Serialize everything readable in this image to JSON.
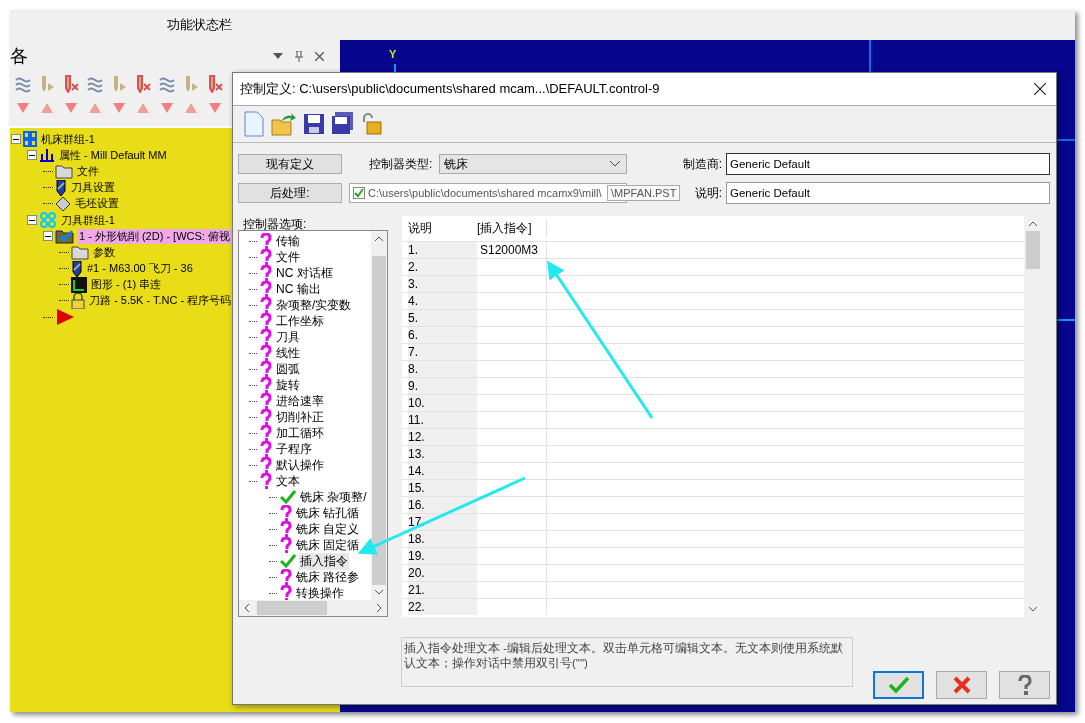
{
  "status_bar": {
    "title": "功能状态栏"
  },
  "manager": {
    "title": "各",
    "tree": [
      {
        "label": "机床群组-1",
        "kind": "machine_group",
        "expanded": true,
        "selected": false,
        "children": [
          {
            "label": "属性 - Mill Default MM",
            "kind": "properties",
            "expanded": true,
            "selected": false,
            "children": [
              {
                "label": "文件",
                "kind": "folder",
                "selected": false
              },
              {
                "label": "刀具设置",
                "kind": "tool",
                "selected": false
              },
              {
                "label": "毛坯设置",
                "kind": "stock",
                "selected": false
              }
            ]
          },
          {
            "label": "刀具群组-1",
            "kind": "tool_group",
            "expanded": true,
            "selected": false,
            "children": [
              {
                "label": "1 - 外形铣削 (2D) - [WCS: 俯视",
                "kind": "operation",
                "expanded": true,
                "selected": true,
                "children": [
                  {
                    "label": "参数",
                    "kind": "folder",
                    "selected": false
                  },
                  {
                    "label": "#1 - M63.00 飞刀 - 36",
                    "kind": "tool",
                    "selected": false
                  },
                  {
                    "label": "图形 - (1) 串连",
                    "kind": "geometry",
                    "selected": false
                  },
                  {
                    "label": "刀路 - 5.5K - T.NC - 程序号码",
                    "kind": "toolpath",
                    "selected": false
                  }
                ]
              },
              {
                "kind": "insert_marker",
                "selected": false
              }
            ]
          }
        ]
      }
    ]
  },
  "viewport": {
    "axis_label": "Y"
  },
  "dialog": {
    "title": "控制定义: C:\\users\\public\\documents\\shared mcam...\\DEFAULT.control-9",
    "current_button": "现有定义",
    "post_button": "后处理:",
    "controller_type": {
      "label": "控制器类型:",
      "value": "铣床"
    },
    "post_path": "C:\\users\\public\\documents\\shared mcamx9\\mill\\",
    "post_tooltip": "\\MPFAN.PST",
    "manufacturer": {
      "label": "制造商:",
      "value": "Generic Default"
    },
    "description": {
      "label": "说明:",
      "value": "Generic Default"
    },
    "options_label": "控制器选项:",
    "options": [
      {
        "label": "传输",
        "checked": false,
        "selected": false
      },
      {
        "label": "文件",
        "checked": false,
        "selected": false
      },
      {
        "label": "NC 对话框",
        "checked": false,
        "selected": false
      },
      {
        "label": "NC 输出",
        "checked": false,
        "selected": false
      },
      {
        "label": "杂项整/实变数",
        "checked": false,
        "selected": false
      },
      {
        "label": "工作坐标",
        "checked": false,
        "selected": false
      },
      {
        "label": "刀具",
        "checked": false,
        "selected": false
      },
      {
        "label": "线性",
        "checked": false,
        "selected": false
      },
      {
        "label": "圆弧",
        "checked": false,
        "selected": false
      },
      {
        "label": "旋转",
        "checked": false,
        "selected": false
      },
      {
        "label": "进给速率",
        "checked": false,
        "selected": false
      },
      {
        "label": "切削补正",
        "checked": false,
        "selected": false
      },
      {
        "label": "加工循环",
        "checked": false,
        "selected": false
      },
      {
        "label": "子程序",
        "checked": false,
        "selected": false
      },
      {
        "label": "默认操作",
        "checked": false,
        "selected": false
      },
      {
        "label": "文本",
        "checked": false,
        "selected": false,
        "children": [
          {
            "label": "铣床 杂项整/",
            "checked": true,
            "selected": false
          },
          {
            "label": "铣床 钻孔循",
            "checked": false,
            "selected": false
          },
          {
            "label": "铣床 自定义",
            "checked": false,
            "selected": false
          },
          {
            "label": "铣床 固定循",
            "checked": false,
            "selected": false
          },
          {
            "label": "插入指令",
            "checked": true,
            "selected": true
          },
          {
            "label": "铣床 路径参",
            "checked": false,
            "selected": false
          },
          {
            "label": "转换操作",
            "checked": false,
            "selected": false
          }
        ]
      }
    ],
    "table": {
      "columns": [
        "说明",
        "[插入指令]"
      ],
      "rows": [
        {
          "label": "1.",
          "value": "S12000M3"
        },
        {
          "label": "2."
        },
        {
          "label": "3."
        },
        {
          "label": "4."
        },
        {
          "label": "5."
        },
        {
          "label": "6."
        },
        {
          "label": "7."
        },
        {
          "label": "8."
        },
        {
          "label": "9."
        },
        {
          "label": "10."
        },
        {
          "label": "11."
        },
        {
          "label": "12."
        },
        {
          "label": "13."
        },
        {
          "label": "14."
        },
        {
          "label": "15."
        },
        {
          "label": "16."
        },
        {
          "label": "17."
        },
        {
          "label": "18."
        },
        {
          "label": "19."
        },
        {
          "label": "20."
        },
        {
          "label": "21."
        },
        {
          "label": "22."
        }
      ]
    },
    "help_text": "插入指令处理文本 -编辑后处理文本。双击单元格可编辑文本。无文本则使用系统默认文本；操作对话中禁用双引号(\"\")",
    "buttons": [
      {
        "kind": "ok",
        "focused": true
      },
      {
        "kind": "cancel",
        "focused": false
      },
      {
        "kind": "help",
        "focused": false
      }
    ]
  }
}
